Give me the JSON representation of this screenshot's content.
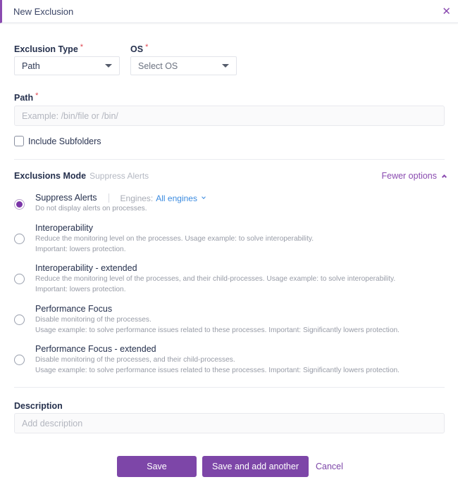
{
  "dialog": {
    "title": "New Exclusion",
    "close_icon": "close-icon",
    "accent_color": "#8a4bb0"
  },
  "exclusion_type": {
    "label": "Exclusion Type",
    "required": "*",
    "value": "Path"
  },
  "os": {
    "label": "OS",
    "required": "*",
    "placeholder": "Select OS"
  },
  "path": {
    "label": "Path",
    "required": "*",
    "value": "",
    "placeholder": "Example: /bin/file or /bin/"
  },
  "include_subfolders": {
    "label": "Include Subfolders",
    "checked": false
  },
  "exclusions_mode": {
    "label": "Exclusions Mode",
    "current_value": "Suppress Alerts",
    "toggle_label": "Fewer options",
    "engines_label": "Engines:",
    "engines_value": "All engines",
    "options": [
      {
        "title": "Suppress Alerts",
        "desc_lines": [
          "Do not display alerts on processes."
        ],
        "selected": true
      },
      {
        "title": "Interoperability",
        "desc_lines": [
          "Reduce the monitoring level on the processes. Usage example: to solve interoperability.",
          "Important: lowers protection."
        ],
        "selected": false
      },
      {
        "title": "Interoperability - extended",
        "desc_lines": [
          "Reduce the monitoring level of the processes, and their child-processes. Usage example: to solve interoperability.",
          "Important: lowers protection."
        ],
        "selected": false
      },
      {
        "title": "Performance Focus",
        "desc_lines": [
          "Disable monitoring of the processes.",
          "Usage example: to solve performance issues related to these processes. Important: Significantly lowers protection."
        ],
        "selected": false
      },
      {
        "title": "Performance Focus - extended",
        "desc_lines": [
          "Disable monitoring of the processes, and their child-processes.",
          "Usage example: to solve performance issues related to these processes. Important: Significantly lowers protection."
        ],
        "selected": false
      }
    ]
  },
  "description": {
    "label": "Description",
    "value": "",
    "placeholder": "Add description"
  },
  "actions": {
    "save": "Save",
    "save_and_add": "Save and add another",
    "cancel": "Cancel"
  }
}
